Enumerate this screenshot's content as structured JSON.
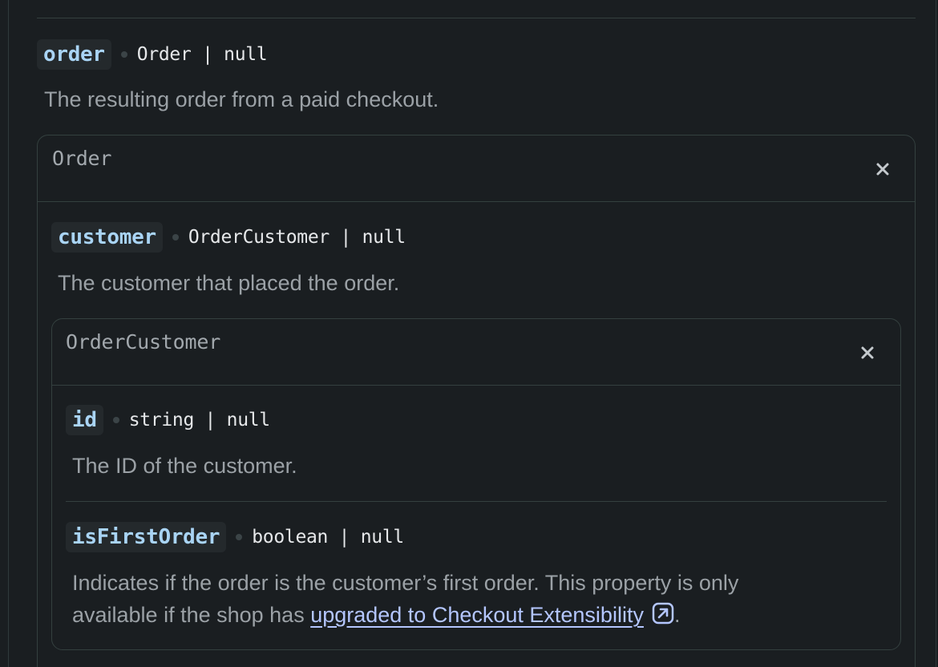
{
  "root_property": {
    "name": "order",
    "type": "Order | null",
    "description": "The resulting order from a paid checkout."
  },
  "order_box": {
    "title": "Order",
    "close_icon": "close-icon",
    "property": {
      "name": "customer",
      "type": "OrderCustomer | null",
      "description": "The customer that placed the order."
    }
  },
  "order_customer_box": {
    "title": "OrderCustomer",
    "close_icon": "close-icon",
    "properties": [
      {
        "name": "id",
        "type": "string | null",
        "description": "The ID of the customer."
      },
      {
        "name": "isFirstOrder",
        "type": "boolean | null",
        "description_line1": "Indicates if the order is the customer’s first order. This property is only",
        "description_line2_prefix": "available if the shop has ",
        "link_text": "upgraded to Checkout Extensibility",
        "link_icon": "external-link-icon",
        "description_suffix": "."
      }
    ]
  },
  "colors": {
    "background": "#1a1e21",
    "property_name": "#a9d4f5",
    "type_text": "#e6e8ea",
    "description_text": "#9ba1a6",
    "border": "#34403f",
    "link": "#b4c6ff"
  }
}
